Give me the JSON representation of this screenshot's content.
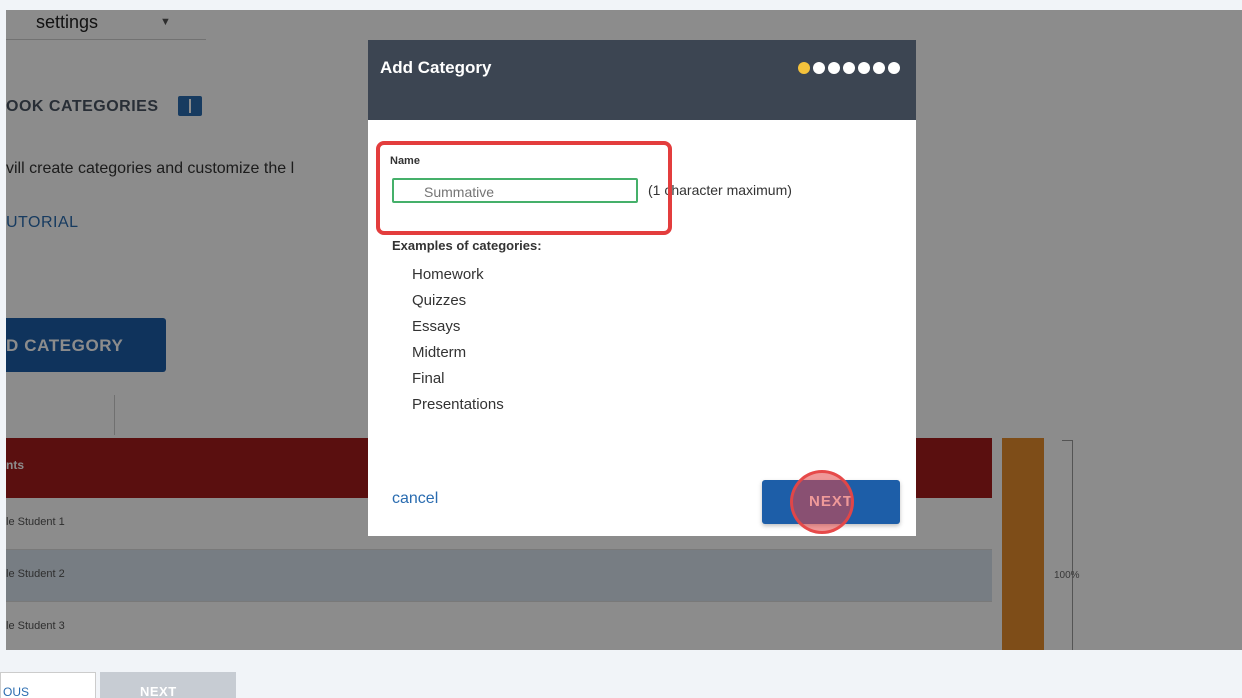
{
  "background": {
    "settings_label": "settings",
    "section_title": "OOK CATEGORIES",
    "description": "vill create categories and customize the l",
    "tutorial_link": "UTORIAL",
    "add_category_button": "D CATEGORY",
    "table": {
      "header": "nts",
      "rows": [
        "le Student 1",
        "le Student 2",
        "le Student 3"
      ]
    },
    "gauge_label": "100%",
    "colors": {
      "header_red": "#a51d1d",
      "button_blue": "#1d5ea8",
      "gauge_orange": "#e58d2c"
    }
  },
  "dialog": {
    "title": "Add Category",
    "progress": {
      "total_steps": 7,
      "current_step": 1
    },
    "name_label": "Name",
    "name_placeholder": "Summative",
    "max_length_note": "(1 character maximum)",
    "examples_title": "Examples of categories:",
    "examples": [
      "Homework",
      "Quizzes",
      "Essays",
      "Midterm",
      "Final",
      "Presentations"
    ],
    "cancel_label": "cancel",
    "next_label": "NEXT"
  },
  "footer": {
    "previous_label": "OUS",
    "next_label": "NEXT"
  }
}
